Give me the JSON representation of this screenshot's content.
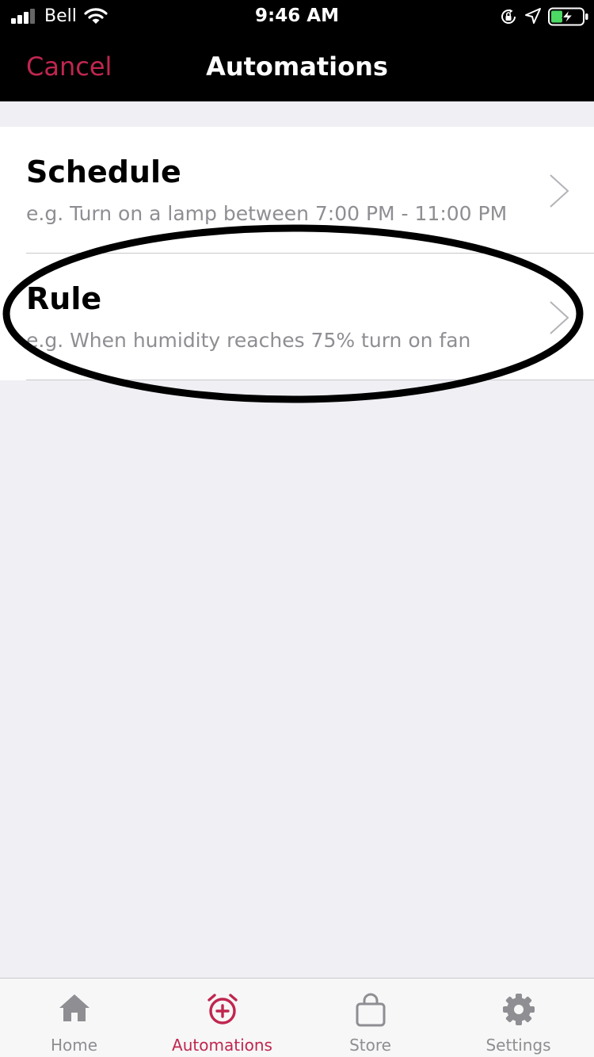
{
  "status_bar": {
    "carrier": "Bell",
    "time": "9:46 AM"
  },
  "nav": {
    "cancel_label": "Cancel",
    "title": "Automations"
  },
  "list": {
    "items": [
      {
        "title": "Schedule",
        "subtitle": "e.g. Turn on a lamp between 7:00 PM - 11:00 PM"
      },
      {
        "title": "Rule",
        "subtitle": "e.g. When humidity reaches 75% turn on fan"
      }
    ]
  },
  "tab_bar": {
    "tabs": [
      {
        "label": "Home",
        "icon": "home-icon"
      },
      {
        "label": "Automations",
        "icon": "alarm-clock-plus-icon",
        "active": true
      },
      {
        "label": "Store",
        "icon": "shopping-bag-icon"
      },
      {
        "label": "Settings",
        "icon": "gear-icon"
      }
    ]
  },
  "colors": {
    "accent": "#c0264f",
    "bar_background": "#000000",
    "page_background": "#efeff4",
    "secondary_text": "#8e8e93"
  }
}
